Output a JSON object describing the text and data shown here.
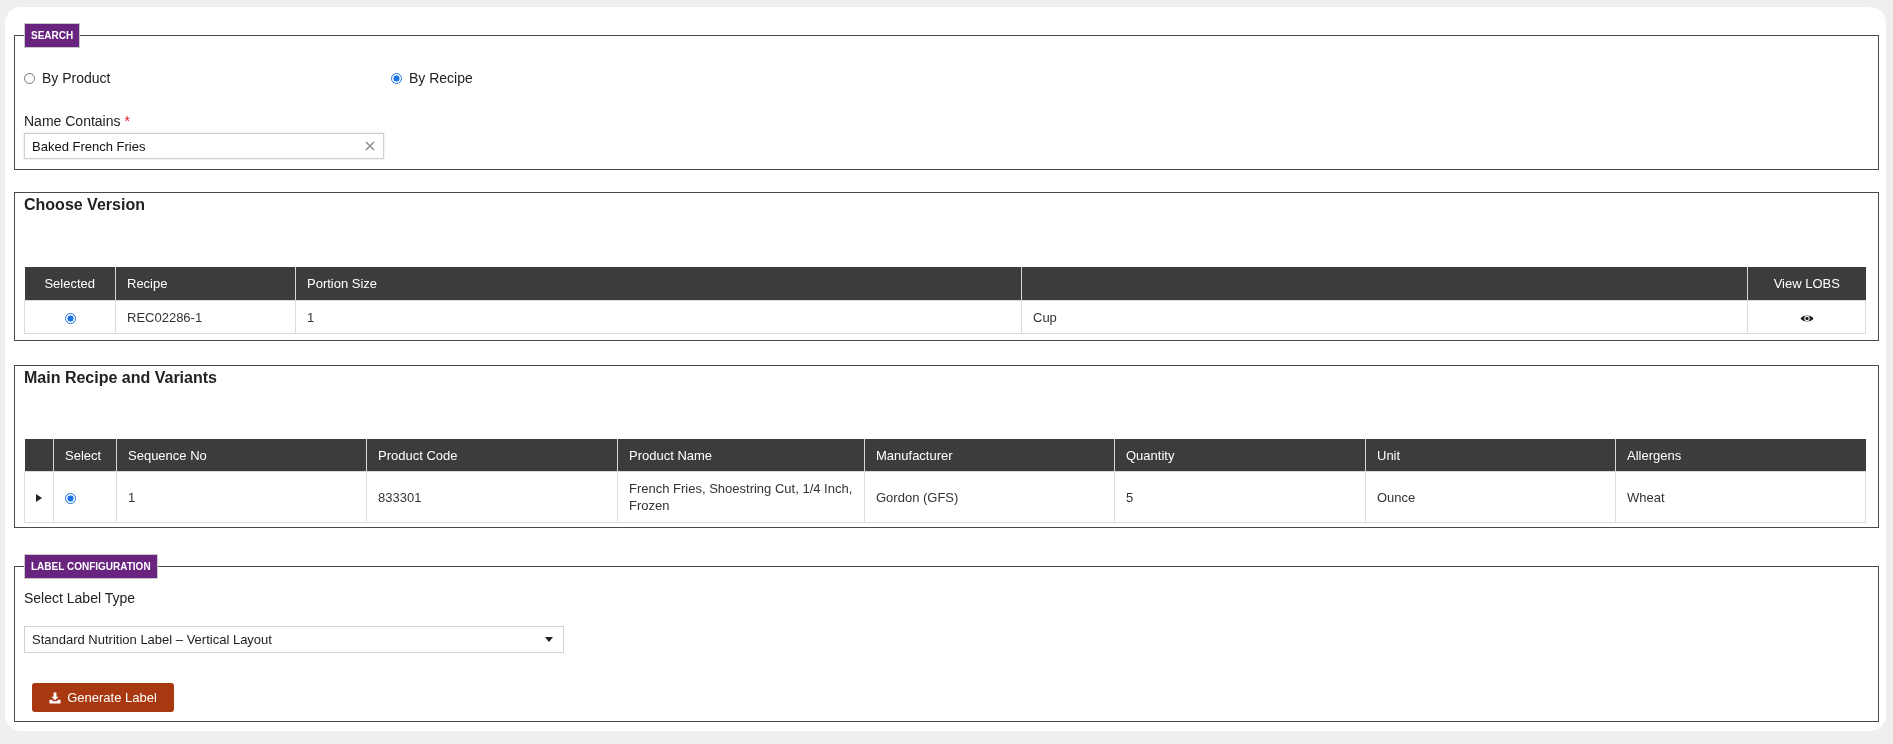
{
  "search": {
    "legend": "SEARCH",
    "options": [
      {
        "label": "By Product",
        "selected": false
      },
      {
        "label": "By Recipe",
        "selected": true
      }
    ],
    "name_field": {
      "label": "Name Contains",
      "required_mark": "*",
      "value": "Baked French Fries"
    }
  },
  "choose_version": {
    "title": "Choose Version",
    "columns": [
      {
        "label": "Selected"
      },
      {
        "label": "Recipe"
      },
      {
        "label": "Portion Size"
      },
      {},
      {
        "label": "View LOBS"
      }
    ],
    "rows": [
      {
        "selected": true,
        "recipe": "REC02286-1",
        "portion_size": "1",
        "column_4": "Cup"
      }
    ]
  },
  "main_recipe": {
    "title": "Main Recipe and Variants",
    "columns": [
      {},
      {
        "label": "Select"
      },
      {
        "label": "Sequence No"
      },
      {
        "label": "Product Code"
      },
      {
        "label": "Product Name"
      },
      {
        "label": "Manufacturer"
      },
      {
        "label": "Quantity"
      },
      {
        "label": "Unit"
      },
      {
        "label": "Allergens"
      }
    ],
    "rows": [
      {
        "expanded": false,
        "selected": true,
        "sequence_no": "1",
        "product_code": "833301",
        "product_name": "French Fries, Shoestring Cut, 1/4 Inch, Frozen",
        "manufacturer": "Gordon (GFS)",
        "quantity": "5",
        "unit": "Ounce",
        "allergens": "Wheat"
      }
    ]
  },
  "label_configuration": {
    "legend": "LABEL CONFIGURATION",
    "field_label": "Select Label Type",
    "selected_option": "Standard Nutrition Label – Vertical Layout",
    "button": "Generate Label"
  }
}
